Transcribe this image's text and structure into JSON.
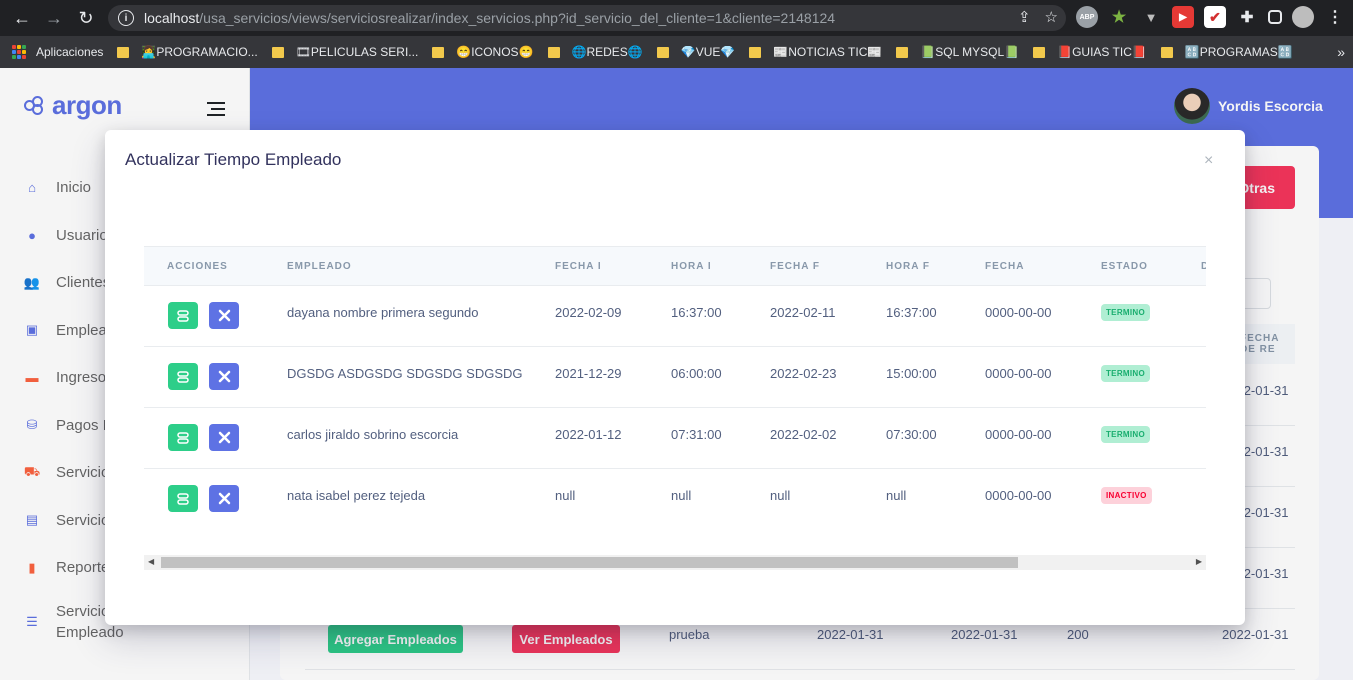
{
  "browser": {
    "url_host": "localhost",
    "url_path": "/usa_servicios/views/serviciosrealizar/index_servicios.php?id_servicio_del_cliente=1&cliente=2148124",
    "extensions": [
      "ABP"
    ],
    "bookmarks": [
      "Aplicaciones",
      "👩‍💻PROGRAMACIO...",
      "🎞PELICULAS SERI...",
      "😁ICONOS😁",
      "🌐REDES🌐",
      "💎VUE💎",
      "📰NOTICIAS TIC📰",
      "📗SQL MYSQL📗",
      "📕GUIAS TIC📕",
      "🔠PROGRAMAS🔠"
    ]
  },
  "app": {
    "brand": "argon",
    "user_name": "Yordis Escorcia",
    "menu": [
      "Inicio",
      "Usuarios",
      "Clientes",
      "Empleados",
      "Ingresos",
      "Pagos R",
      "Servicios",
      "Servicios",
      "Reportes",
      "Servicio Empleado"
    ],
    "top_button": "Otras",
    "bg_header": "FECHA DE RE",
    "bg_dates": [
      "2022-01-31",
      "2022-01-31",
      "2022-01-31",
      "2022-01-31",
      "2022-01-31"
    ],
    "bg_row": {
      "add_btn": "Agregar Empleados",
      "view_btn": "Ver Empleados",
      "desc": "prueba",
      "d1": "2022-01-31",
      "d2": "2022-01-31",
      "num": "200",
      "d3": "2022-01-31"
    }
  },
  "modal": {
    "title": "Actualizar Tiempo Empleado",
    "close": "×",
    "columns": [
      "ACCIONES",
      "EMPLEADO",
      "FECHA I",
      "HORA I",
      "FECHA F",
      "HORA F",
      "FECHA",
      "ESTADO",
      "D"
    ],
    "rows": [
      {
        "empleado": "dayana nombre primera segundo",
        "fecha_i": "2022-02-09",
        "hora_i": "16:37:00",
        "fecha_f": "2022-02-11",
        "hora_f": "16:37:00",
        "fecha": "0000-00-00",
        "estado": "TERMINO"
      },
      {
        "empleado": "DGSDG ASDGSDG SDGSDG SDGSDG",
        "fecha_i": "2021-12-29",
        "hora_i": "06:00:00",
        "fecha_f": "2022-02-23",
        "hora_f": "15:00:00",
        "fecha": "0000-00-00",
        "estado": "TERMINO"
      },
      {
        "empleado": "carlos jiraldo sobrino escorcia",
        "fecha_i": "2022-01-12",
        "hora_i": "07:31:00",
        "fecha_f": "2022-02-02",
        "hora_f": "07:30:00",
        "fecha": "0000-00-00",
        "estado": "TERMINO"
      },
      {
        "empleado": "nata isabel perez tejeda",
        "fecha_i": "null",
        "hora_i": "null",
        "fecha_f": "null",
        "hora_f": "null",
        "fecha": "0000-00-00",
        "estado": "INACTIVO"
      }
    ]
  },
  "colors": {
    "primary": "#5e72e4",
    "success": "#2dce89",
    "danger": "#f5365c"
  }
}
